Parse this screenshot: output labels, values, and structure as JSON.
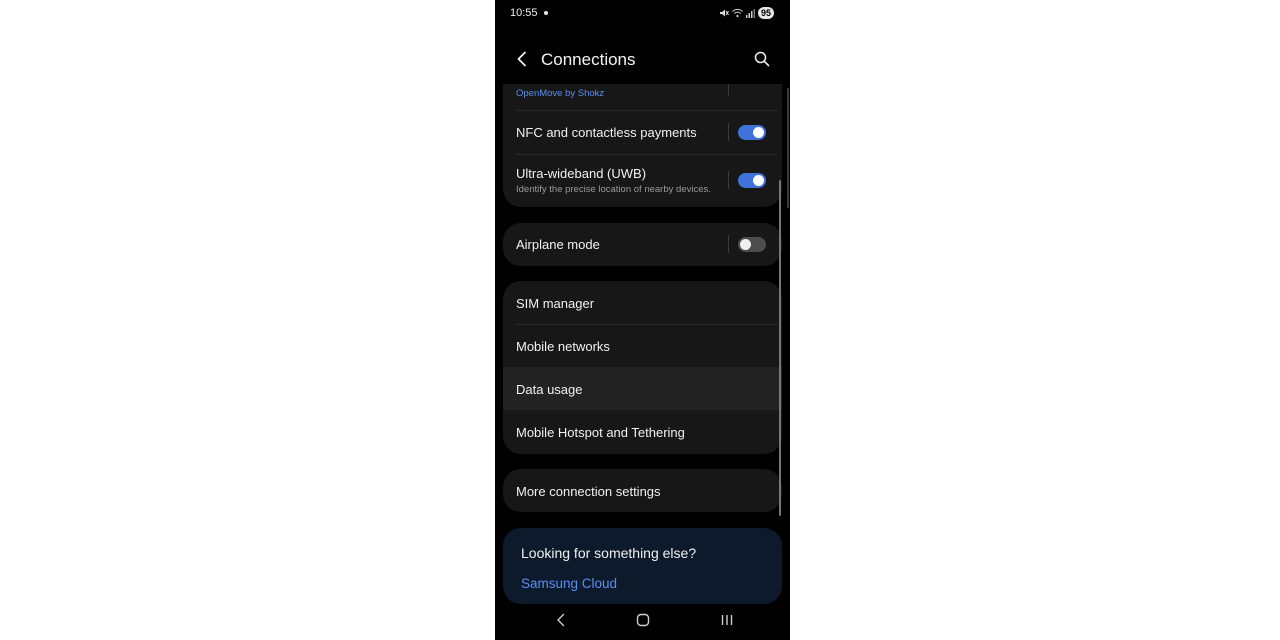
{
  "status_bar": {
    "time": "10:55",
    "battery": "95"
  },
  "header": {
    "title": "Connections"
  },
  "card_top": {
    "rows": [
      {
        "subtitle": "OpenMove by Shokz",
        "toggle": "on"
      },
      {
        "title": "NFC and contactless payments",
        "toggle": "on"
      },
      {
        "title": "Ultra-wideband (UWB)",
        "subtitle": "Identify the precise location of nearby devices.",
        "toggle": "on"
      }
    ]
  },
  "card_airplane": {
    "title": "Airplane mode",
    "toggle": "off"
  },
  "card_mobile": {
    "items": [
      {
        "label": "SIM manager"
      },
      {
        "label": "Mobile networks"
      },
      {
        "label": "Data usage"
      },
      {
        "label": "Mobile Hotspot and Tethering"
      }
    ]
  },
  "card_more": {
    "label": "More connection settings"
  },
  "promo": {
    "title": "Looking for something else?",
    "link": "Samsung Cloud"
  },
  "colors": {
    "accent": "#3f73d9",
    "link": "#5d8ff2",
    "background": "#010101",
    "card": "#171717"
  },
  "icons": [
    "back-icon",
    "search-icon",
    "mute-icon",
    "wifi-icon",
    "signal-icon",
    "nav-back-icon",
    "nav-home-icon",
    "nav-recents-icon"
  ]
}
